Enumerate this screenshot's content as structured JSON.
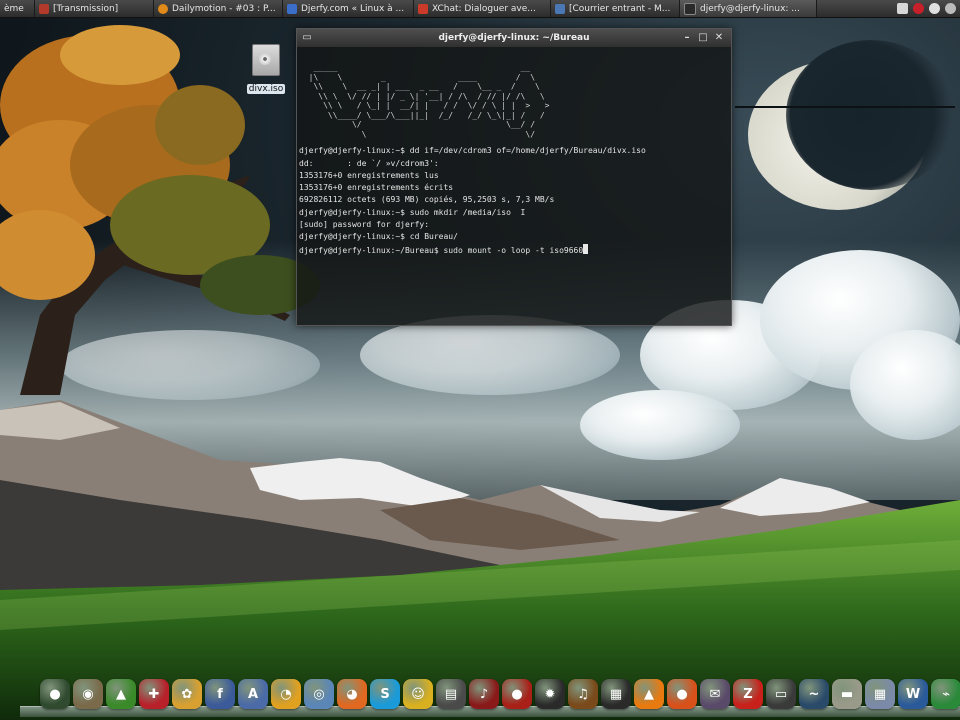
{
  "taskbar": {
    "tasks": [
      {
        "label": "ème",
        "color": "#6a6a6a"
      },
      {
        "label": "[Transmission]",
        "color": "#b33a2a"
      },
      {
        "label": "Dailymotion - #03 : P...",
        "color": "#e08a1a"
      },
      {
        "label": "Djerfy.com « Linux à ...",
        "color": "#3a6ec8"
      },
      {
        "label": "XChat: Dialoguer ave...",
        "color": "#cc3b2a"
      },
      {
        "label": "[Courrier entrant - M...",
        "color": "#4a78b4"
      },
      {
        "label": "djerfy@djerfy-linux: ...",
        "color": "#2a2a2a"
      }
    ]
  },
  "desktop": {
    "icon_label": "divx.iso"
  },
  "terminal": {
    "title": "djerfy@djerfy-linux: ~/Bureau",
    "lines": [
      "djerfy@djerfy-linux:~$ dd if=/dev/cdrom3 of=/home/djerfy/Bureau/divx.iso",
      "dd:       : de `/ »v/cdrom3':",
      "1353176+0 enregistrements lus",
      "1353176+0 enregistrements écrits",
      "692826112 octets (693 MB) copiés, 95,2503 s, 7,3 MB/s",
      "djerfy@djerfy-linux:~$ sudo mkdir /media/iso  I",
      "[sudo] password for djerfy:",
      "djerfy@djerfy-linux:~$ cd Bureau/",
      "djerfy@djerfy-linux:~/Bureau$ sudo mount -o loop -t iso9660"
    ]
  },
  "dock": {
    "apps": [
      {
        "icon": "gnome-globe-icon",
        "glyph": "●",
        "color": "#2f4a2f"
      },
      {
        "icon": "gimp-icon",
        "glyph": "◉",
        "color": "#7a6a4a"
      },
      {
        "icon": "tux-icon",
        "glyph": "▲",
        "color": "#3a8a2a"
      },
      {
        "icon": "redbook-icon",
        "glyph": "✚",
        "color": "#b8202a"
      },
      {
        "icon": "picasa-icon",
        "glyph": "✿",
        "color": "#d8a030"
      },
      {
        "icon": "facebook-icon",
        "glyph": "f",
        "color": "#3b5a9a"
      },
      {
        "icon": "pidgin-icon",
        "glyph": "A",
        "color": "#4a6aa8"
      },
      {
        "icon": "chat-bubble-icon",
        "glyph": "◔",
        "color": "#e0a020"
      },
      {
        "icon": "disk-utility-icon",
        "glyph": "◎",
        "color": "#5a86b8"
      },
      {
        "icon": "firefox-icon",
        "glyph": "◕",
        "color": "#e06820"
      },
      {
        "icon": "skype-icon",
        "glyph": "S",
        "color": "#1a9ad8"
      },
      {
        "icon": "emesene-icon",
        "glyph": "☺",
        "color": "#d8b020"
      },
      {
        "icon": "printer-icon",
        "glyph": "▤",
        "color": "#4a4a4a"
      },
      {
        "icon": "audacity-icon",
        "glyph": "♪",
        "color": "#8a1a1a"
      },
      {
        "icon": "tomato-icon",
        "glyph": "●",
        "color": "#a82018"
      },
      {
        "icon": "bomb-icon",
        "glyph": "✹",
        "color": "#2a2a2a"
      },
      {
        "icon": "guitar-icon",
        "glyph": "♫",
        "color": "#7a4a1a"
      },
      {
        "icon": "clapperboard-icon",
        "glyph": "▦",
        "color": "#2a2a2a"
      },
      {
        "icon": "vlc-icon",
        "glyph": "▲",
        "color": "#e87a10"
      },
      {
        "icon": "orange-ball-icon",
        "glyph": "●",
        "color": "#d8501a"
      },
      {
        "icon": "thunderbird-icon",
        "glyph": "✉",
        "color": "#5a4a6a"
      },
      {
        "icon": "filezilla-icon",
        "glyph": "Z",
        "color": "#c8201a"
      },
      {
        "icon": "terminal-icon",
        "glyph": "▭",
        "color": "#3a3a3a"
      },
      {
        "icon": "monitor-icon",
        "glyph": "~",
        "color": "#2a4a6a"
      },
      {
        "icon": "drive-icon",
        "glyph": "▬",
        "color": "#9a9a8a"
      },
      {
        "icon": "calendar-icon",
        "glyph": "▦",
        "color": "#7a8aa8"
      },
      {
        "icon": "wordpress-icon",
        "glyph": "W",
        "color": "#2a5a9a"
      },
      {
        "icon": "trash-icon",
        "glyph": "⌁",
        "color": "#2a8a3a"
      }
    ]
  }
}
